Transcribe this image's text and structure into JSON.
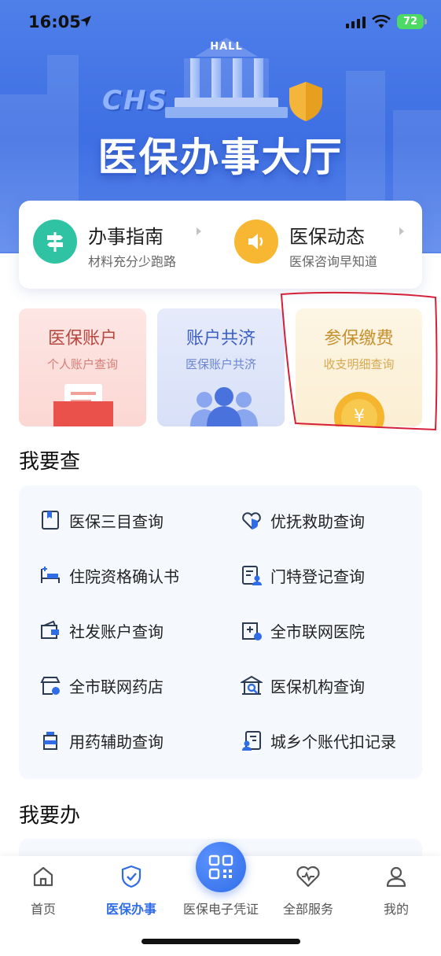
{
  "status_bar": {
    "time": "16:05",
    "battery": "72"
  },
  "hero": {
    "badge": "HALL",
    "logo": "CHS",
    "title": "医保办事大厅"
  },
  "guide": [
    {
      "title": "办事指南",
      "subtitle": "材料充分少跑路",
      "icon": "signpost-icon",
      "color": "#2fc3a3"
    },
    {
      "title": "医保动态",
      "subtitle": "医保咨询早知道",
      "icon": "speaker-icon",
      "color": "#f7b733"
    }
  ],
  "tiles": [
    {
      "title": "医保账户",
      "subtitle": "个人账户查询"
    },
    {
      "title": "账户共济",
      "subtitle": "医保账户共济"
    },
    {
      "title": "参保缴费",
      "subtitle": "收支明细查询"
    }
  ],
  "query_section": {
    "title": "我要查",
    "items": [
      {
        "label": "医保三目查询",
        "icon": "bookmark-doc-icon"
      },
      {
        "label": "优抚救助查询",
        "icon": "heart-shield-icon"
      },
      {
        "label": "住院资格确认书",
        "icon": "hospital-bed-icon"
      },
      {
        "label": "门特登记查询",
        "icon": "doc-person-icon"
      },
      {
        "label": "社发账户查询",
        "icon": "wallet-icon"
      },
      {
        "label": "全市联网医院",
        "icon": "hospital-icon"
      },
      {
        "label": "全市联网药店",
        "icon": "pharmacy-store-icon"
      },
      {
        "label": "医保机构查询",
        "icon": "institution-icon"
      },
      {
        "label": "用药辅助查询",
        "icon": "medicine-bottle-icon"
      },
      {
        "label": "城乡个账代扣记录",
        "icon": "doc-user-icon"
      }
    ]
  },
  "todo_section": {
    "title": "我要办"
  },
  "tabbar": [
    {
      "label": "首页",
      "icon": "home-icon",
      "active": false
    },
    {
      "label": "医保办事",
      "icon": "shield-check-icon",
      "active": true
    },
    {
      "label": "医保电子凭证",
      "icon": "qr-code-icon",
      "active": false
    },
    {
      "label": "全部服务",
      "icon": "heart-pulse-icon",
      "active": false
    },
    {
      "label": "我的",
      "icon": "user-icon",
      "active": false
    }
  ],
  "colors": {
    "brand_blue": "#2f6ce6",
    "annotation_red": "#d6203a"
  }
}
